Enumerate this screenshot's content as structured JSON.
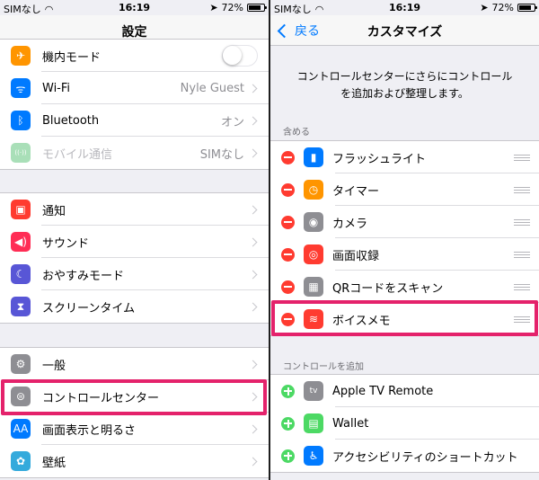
{
  "left": {
    "status": {
      "carrier": "SIMなし",
      "time": "16:19",
      "battery": "72%"
    },
    "title": "設定",
    "group1": [
      {
        "label": "機内モード",
        "icon": "airplane-icon",
        "color": "#ff9500",
        "glyph": "✈"
      },
      {
        "label": "Wi-Fi",
        "value": "Nyle Guest",
        "icon": "wifi-icon",
        "color": "#007aff",
        "glyph": "ᯤ"
      },
      {
        "label": "Bluetooth",
        "value": "オン",
        "icon": "bluetooth-icon",
        "color": "#007aff",
        "glyph": "ᛒ"
      },
      {
        "label": "モバイル通信",
        "value": "SIMなし",
        "icon": "cellular-icon",
        "color": "#a9dfb8",
        "glyph": "((·))",
        "dim": true
      }
    ],
    "group2": [
      {
        "label": "通知",
        "icon": "notifications-icon",
        "color": "#ff3b30",
        "glyph": "▣"
      },
      {
        "label": "サウンド",
        "icon": "sounds-icon",
        "color": "#ff2d55",
        "glyph": "◀)"
      },
      {
        "label": "おやすみモード",
        "icon": "moon-icon",
        "color": "#5856d6",
        "glyph": "☾"
      },
      {
        "label": "スクリーンタイム",
        "icon": "hourglass-icon",
        "color": "#5856d6",
        "glyph": "⧗"
      }
    ],
    "group3": [
      {
        "label": "一般",
        "icon": "gear-icon",
        "color": "#8e8e93",
        "glyph": "⚙"
      },
      {
        "label": "コントロールセンター",
        "icon": "control-center-icon",
        "color": "#8e8e93",
        "glyph": "⊜"
      },
      {
        "label": "画面表示と明るさ",
        "icon": "display-icon",
        "color": "#007aff",
        "glyph": "AA"
      },
      {
        "label": "壁紙",
        "icon": "wallpaper-icon",
        "color": "#34aadc",
        "glyph": "✿"
      }
    ],
    "highlight_color": "#e4226b"
  },
  "right": {
    "status": {
      "carrier": "SIMなし",
      "time": "16:19",
      "battery": "72%"
    },
    "back": "戻る",
    "title": "カスタマイズ",
    "description_line1": "コントロールセンターにさらにコントロール",
    "description_line2": "を追加および整理します。",
    "included_header": "含める",
    "included": [
      {
        "label": "フラッシュライト",
        "icon": "flashlight-icon",
        "color": "#007aff",
        "glyph": "▮"
      },
      {
        "label": "タイマー",
        "icon": "timer-icon",
        "color": "#ff9500",
        "glyph": "◷"
      },
      {
        "label": "カメラ",
        "icon": "camera-icon",
        "color": "#8e8e93",
        "glyph": "◉"
      },
      {
        "label": "画面収録",
        "icon": "screen-record-icon",
        "color": "#ff3b30",
        "glyph": "◎"
      },
      {
        "label": "QRコードをスキャン",
        "icon": "qr-icon",
        "color": "#8e8e93",
        "glyph": "▦"
      },
      {
        "label": "ボイスメモ",
        "icon": "voice-memo-icon",
        "color": "#ff3b30",
        "glyph": "≋"
      }
    ],
    "more_header": "コントロールを追加",
    "more": [
      {
        "label": "Apple TV Remote",
        "icon": "apple-tv-icon",
        "color": "#8e8e93",
        "glyph": "tv"
      },
      {
        "label": "Wallet",
        "icon": "wallet-icon",
        "color": "#4cd964",
        "glyph": "▤"
      },
      {
        "label": "アクセシビリティのショートカット",
        "icon": "accessibility-icon",
        "color": "#007aff",
        "glyph": "♿"
      }
    ]
  }
}
